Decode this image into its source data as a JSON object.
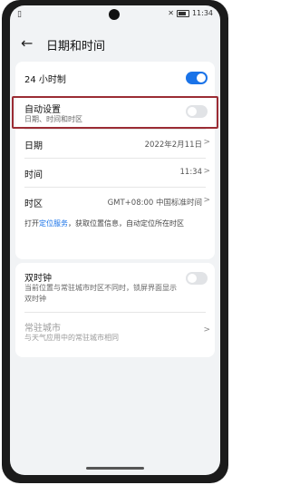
{
  "status": {
    "left_icon": "sim-icon",
    "time": "11:34",
    "icons": [
      "mute-icon",
      "battery-icon"
    ]
  },
  "header": {
    "title": "日期和时间",
    "back_icon": "arrow-left-icon"
  },
  "settings": {
    "h24": {
      "label": "24 小时制",
      "enabled": true
    },
    "auto": {
      "label": "自动设置",
      "sub": "日期、时间和时区",
      "enabled": false
    },
    "date": {
      "label": "日期",
      "value": "2022年2月11日"
    },
    "time": {
      "label": "时间",
      "value": "11:34"
    },
    "tz": {
      "label": "时区",
      "value": "GMT+08:00 中国标准时间"
    }
  },
  "hint": {
    "prefix": "打开",
    "link": "定位服务",
    "suffix": "，获取位置信息，自动定位所在时区"
  },
  "dual_clock": {
    "label": "双时钟",
    "sub": "当前位置与常驻城市时区不同时，锁屏界面显示双时钟",
    "enabled": false
  },
  "resident_city": {
    "label": "常驻城市",
    "sub": "与天气应用中的常驻城市相同"
  },
  "colors": {
    "accent": "#1a73e8",
    "highlight": "#9b2c34"
  }
}
